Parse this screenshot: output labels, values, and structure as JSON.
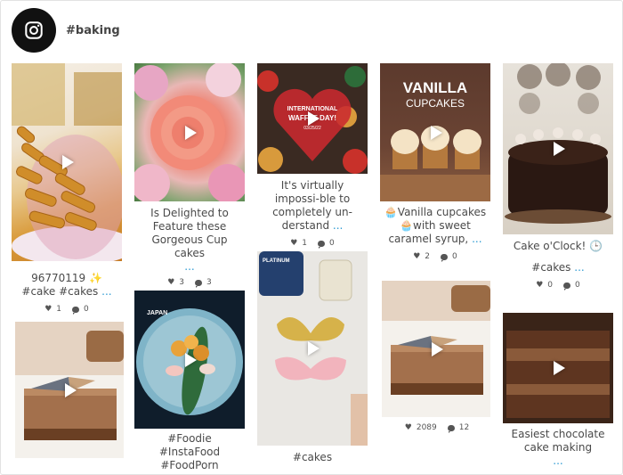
{
  "header": {
    "hashtag": "#baking",
    "icon": "instagram-icon"
  },
  "posts": {
    "p1": {
      "caption": "96770119 ✨",
      "caption2": "#cake #cakes",
      "more": "...",
      "likes": "1",
      "comments": "0"
    },
    "p2": {
      "caption": "",
      "caption2": "",
      "more": "",
      "likes": "",
      "comments": ""
    },
    "p3": {
      "caption": "Is Delighted to Feature these Gorgeous Cup cakes",
      "more": "...",
      "likes": "3",
      "comments": "3"
    },
    "p4": {
      "caption": "#Foodie #InstaFood #FoodPorn #NomNom",
      "overlay": "JAPAN"
    },
    "p5": {
      "caption": "It's virtually impossi-ble to completely un-derstand",
      "more": "...",
      "likes": "1",
      "comments": "0",
      "overlay1": "INTERNATIONAL",
      "overlay2": "WAFFLE DAY!",
      "overlay3": "03/25/22"
    },
    "p6": {
      "caption": "#cakes",
      "overlay": "PLATINUM"
    },
    "p7": {
      "caption": "🧁Vanilla cupcakes 🧁with sweet caramel syrup,",
      "more": "...",
      "likes": "2",
      "comments": "0",
      "overlay1": "VANILLA",
      "overlay2": "CUPCAKES"
    },
    "p8": {
      "likes": "2089",
      "comments": "12"
    },
    "p9": {
      "caption": "Cake o'Clock! 🕒",
      "caption2": "#cakes",
      "more": "...",
      "likes": "0",
      "comments": "0"
    },
    "p10": {
      "caption": "Easiest chocolate cake making",
      "more": "..."
    }
  }
}
